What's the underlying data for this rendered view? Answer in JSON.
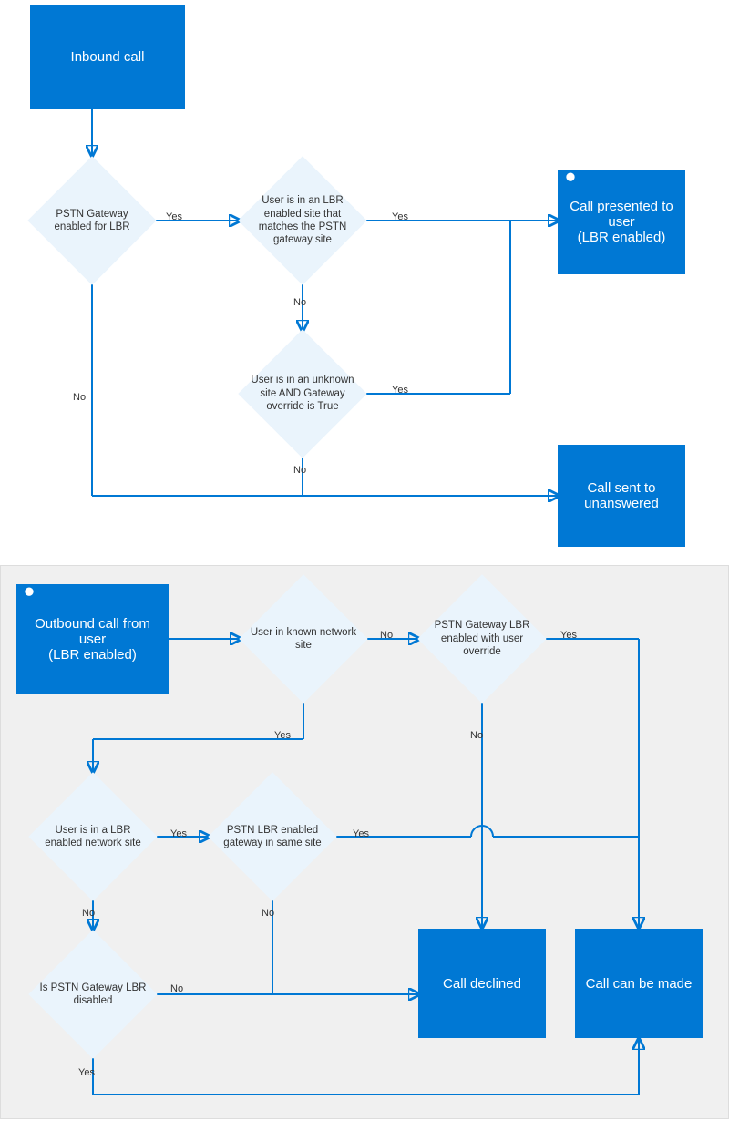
{
  "colors": {
    "primary": "#0078d4",
    "diamond_fill": "#eaf4fc",
    "panel_bg": "#f0f0f0"
  },
  "labels": {
    "yes": "Yes",
    "no": "No"
  },
  "top": {
    "start": "Inbound call",
    "d1": "PSTN Gateway enabled for LBR",
    "d2": "User is in an LBR enabled site that matches the PSTN gateway site",
    "d3": "User is in an unknown site AND Gateway override is True",
    "out1": "Call presented to user\n(LBR enabled)",
    "out2": "Call sent to unanswered"
  },
  "bottom": {
    "start": "Outbound call from user\n(LBR enabled)",
    "d1": "User in known network site",
    "d2": "PSTN Gateway LBR enabled with user override",
    "d3": "User is in a LBR enabled network site",
    "d4": "PSTN LBR enabled gateway in same site",
    "d5": "Is PSTN Gateway LBR disabled",
    "out1": "Call declined",
    "out2": "Call can be made"
  }
}
